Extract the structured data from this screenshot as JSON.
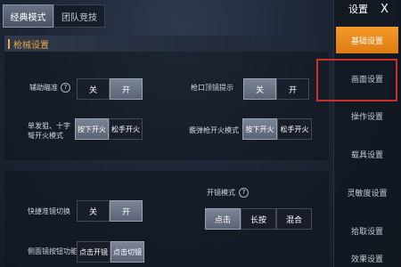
{
  "tabs": [
    "经典模式",
    "团队竞技"
  ],
  "section_title": "枪械设置",
  "settings": {
    "aim_assist": {
      "label": "辅助瞄准",
      "options": [
        "关",
        "开"
      ],
      "selected": "开"
    },
    "muzzle_hint": {
      "label": "枪口顶镜提示",
      "options": [
        "关",
        "开"
      ],
      "selected": "关"
    },
    "fire_mode_single": {
      "label_line1": "单发狙、十字",
      "label_line2": "弩开火模式",
      "options": [
        "按下开火",
        "松手开火"
      ],
      "selected": "按下开火"
    },
    "shotgun_fire": {
      "label": "霰弹枪开火模式",
      "options": [
        "按下开火",
        "松手开火"
      ],
      "selected": "按下开火"
    },
    "quick_scope": {
      "label": "快捷准镜切换",
      "options": [
        "关",
        "开"
      ],
      "selected": "开"
    },
    "scope_mode": {
      "label": "开镜模式",
      "options": [
        "点击",
        "长按",
        "混合"
      ],
      "selected": "点击"
    },
    "side_scope": {
      "label": "侧面镜按钮功能",
      "options": [
        "点击开镜",
        "点击切镜"
      ],
      "selected": "点击切镜"
    }
  },
  "sidebar": {
    "title": "设置",
    "close": "X",
    "items": [
      "基础设置",
      "画面设置",
      "操作设置",
      "载具设置",
      "灵敏度设置",
      "拾取设置",
      "效果设置"
    ],
    "active": "基础设置",
    "highlighted": "画面设置"
  },
  "colors": {
    "accent": "#e9a840",
    "active_tab": "#f39a2a",
    "highlight": "#c9302b"
  }
}
